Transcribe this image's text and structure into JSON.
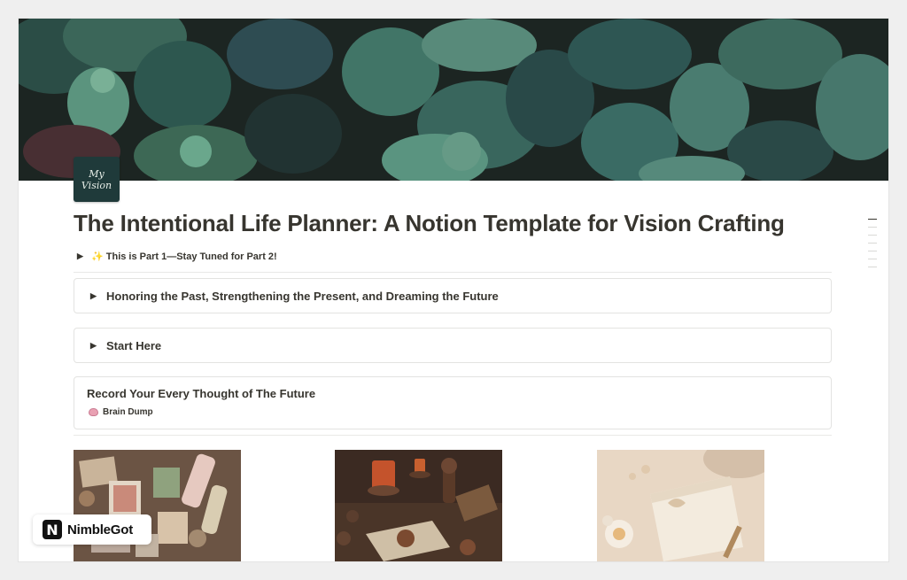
{
  "page": {
    "icon_text": [
      "My",
      "Vision"
    ],
    "title": "The Intentional Life Planner: A Notion Template for Vision Crafting",
    "callout_toggle": "✨ This is Part 1—Stay Tuned for Part 2!",
    "toggle_blocks": [
      {
        "label": "Honoring the Past, Strengthening the Present, and Dreaming the Future"
      },
      {
        "label": "Start Here"
      }
    ],
    "record_block": {
      "heading": "Record Your Every Thought of The Future",
      "link_label": "Brain Dump",
      "link_icon": "brain-icon"
    },
    "gallery": [
      {
        "image": "craft-supplies-image"
      },
      {
        "image": "candles-wax-seal-image"
      },
      {
        "image": "paper-flower-image"
      }
    ]
  },
  "watermark": {
    "logo_letter": "N",
    "name": "NimbleGot"
  },
  "colors": {
    "icon_bg": "#1f3a3a",
    "text": "#37352f",
    "border": "#e3e3e1"
  }
}
